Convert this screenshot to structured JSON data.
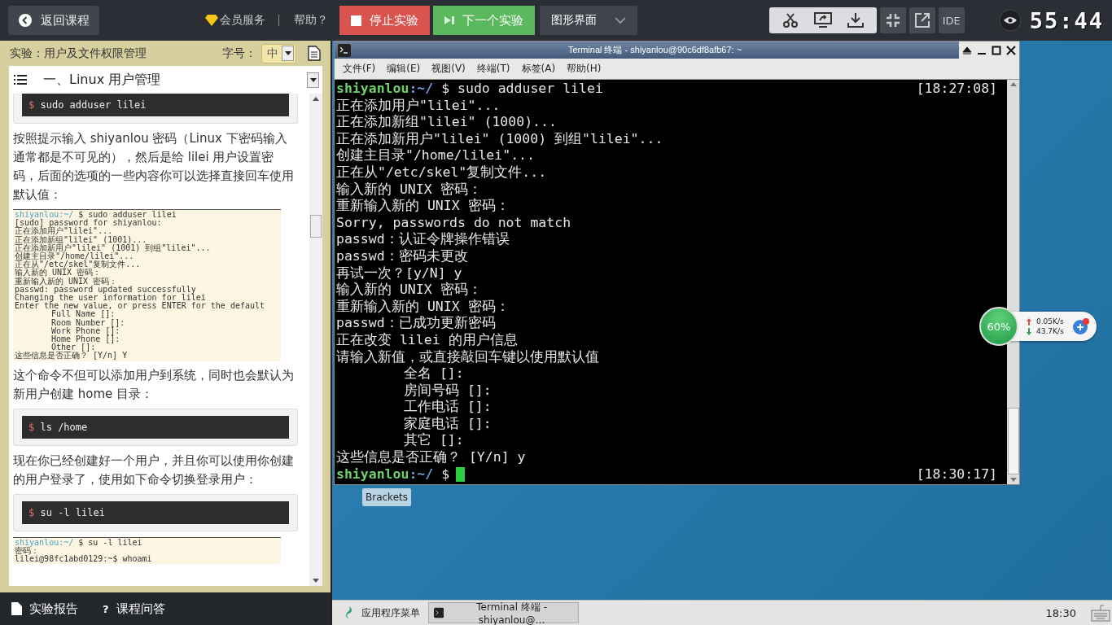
{
  "topbar": {
    "back_button": "返回课程",
    "vip_link": "会员服务",
    "help_link": "帮助？",
    "stop_button": "停止实验",
    "next_button": "下一个实验",
    "view_dropdown": "图形界面",
    "ide_button": "IDE",
    "timer": "55:44"
  },
  "lesson": {
    "title": "实验：用户及文件权限管理",
    "font_size_label": "字号：",
    "font_size_value": "中",
    "section": "一、Linux 用户管理",
    "blocks": [
      {
        "kind": "code",
        "prompt": "$",
        "text": "sudo adduser lilei"
      },
      {
        "kind": "paragraph",
        "text": "按照提示输入 shiyanlou 密码（Linux 下密码输入通常都是不可见的），然后是给 lilei 用户设置密码，后面的选项的一些内容你可以选择直接回车使用默认值："
      },
      {
        "kind": "screenshot",
        "user": "shiyanlou",
        "path": ":~/",
        "command": "$ sudo adduser lilei",
        "lines": [
          {
            "text": "[sudo] password for shiyanlou:",
            "indented": false
          },
          {
            "text": "正在添加用户\"lilei\"...",
            "indented": false
          },
          {
            "text": "正在添加新组\"lilei\" (1001)...",
            "indented": false
          },
          {
            "text": "正在添加新用户\"lilei\" (1001) 到组\"lilei\"...",
            "indented": false
          },
          {
            "text": "创建主目录\"/home/lilei\"...",
            "indented": false
          },
          {
            "text": "正在从\"/etc/skel\"复制文件...",
            "indented": false
          },
          {
            "text": "输入新的 UNIX 密码：",
            "indented": false
          },
          {
            "text": "重新输入新的 UNIX 密码：",
            "indented": false
          },
          {
            "text": "passwd: password updated successfully",
            "indented": false
          },
          {
            "text": "Changing the user information for lilei",
            "indented": false
          },
          {
            "text": "Enter the new value, or press ENTER for the default",
            "indented": false
          },
          {
            "text": "Full Name []:",
            "indented": true
          },
          {
            "text": "Room Number []:",
            "indented": true
          },
          {
            "text": "Work Phone []:",
            "indented": true
          },
          {
            "text": "Home Phone []:",
            "indented": true
          },
          {
            "text": "Other []:",
            "indented": true
          },
          {
            "text": "这些信息是否正确？ [Y/n] Y",
            "indented": false
          }
        ]
      },
      {
        "kind": "paragraph",
        "text": "这个命令不但可以添加用户到系统，同时也会默认为新用户创建 home 目录："
      },
      {
        "kind": "code",
        "prompt": "$",
        "text": "ls /home"
      },
      {
        "kind": "paragraph",
        "text": "现在你已经创建好一个用户，并且你可以使用你创建的用户登录了，使用如下命令切换登录用户："
      },
      {
        "kind": "code",
        "prompt": "$",
        "text": "su -l lilei"
      },
      {
        "kind": "screenshot",
        "user": "shiyanlou",
        "path": ":~/",
        "command": "$ su -l lilei",
        "lines": [
          {
            "text": "密码：",
            "indented": false
          },
          {
            "text": "lilei@98fc1abd0129:~$ whoami",
            "indented": false
          }
        ]
      }
    ],
    "bottom_tabs": [
      {
        "label": "实验报告"
      },
      {
        "label": "课程问答",
        "icon": "?"
      }
    ]
  },
  "terminal": {
    "title": "Terminal 终端 - shiyanlou@90c6df8afb67: ~",
    "menu": [
      "文件(F)",
      "编辑(E)",
      "视图(V)",
      "终端(T)",
      "标签(A)",
      "帮助(H)"
    ],
    "lines": [
      {
        "kind": "prompt",
        "user": "shiyanlou",
        "path": ":~/",
        "command": "$ sudo adduser lilei",
        "time": "[18:27:08]",
        "cursor": false
      },
      {
        "kind": "output",
        "text": "正在添加用户\"lilei\"..."
      },
      {
        "kind": "output",
        "text": "正在添加新组\"lilei\" (1000)..."
      },
      {
        "kind": "output",
        "text": "正在添加新用户\"lilei\" (1000) 到组\"lilei\"..."
      },
      {
        "kind": "output",
        "text": "创建主目录\"/home/lilei\"..."
      },
      {
        "kind": "output",
        "text": "正在从\"/etc/skel\"复制文件..."
      },
      {
        "kind": "output",
        "text": "输入新的 UNIX 密码："
      },
      {
        "kind": "output",
        "text": "重新输入新的 UNIX 密码："
      },
      {
        "kind": "output",
        "text": "Sorry, passwords do not match"
      },
      {
        "kind": "output",
        "text": "passwd：认证令牌操作错误"
      },
      {
        "kind": "output",
        "text": "passwd：密码未更改"
      },
      {
        "kind": "output",
        "text": "再试一次？[y/N] y"
      },
      {
        "kind": "output",
        "text": "输入新的 UNIX 密码："
      },
      {
        "kind": "output",
        "text": "重新输入新的 UNIX 密码："
      },
      {
        "kind": "output",
        "text": "passwd：已成功更新密码"
      },
      {
        "kind": "output",
        "text": "正在改变 lilei 的用户信息"
      },
      {
        "kind": "output",
        "text": "请输入新值，或直接敲回车键以使用默认值"
      },
      {
        "kind": "indented",
        "text": "全名 []:"
      },
      {
        "kind": "indented",
        "text": "房间号码 []:"
      },
      {
        "kind": "indented",
        "text": "工作电话 []:"
      },
      {
        "kind": "indented",
        "text": "家庭电话 []:"
      },
      {
        "kind": "indented",
        "text": "其它 []:"
      },
      {
        "kind": "output",
        "text": "这些信息是否正确？ [Y/n] y"
      },
      {
        "kind": "prompt",
        "user": "shiyanlou",
        "path": ":~/",
        "command": "$",
        "time": "[18:30:17]",
        "cursor": true
      }
    ]
  },
  "network_widget": {
    "percent": "60%",
    "upload": "0.05K/s",
    "download": "43.7K/s"
  },
  "desktop_icon": "Brackets",
  "taskbar": {
    "menu_button": "应用程序菜单",
    "task": "Terminal 终端 - shiyanlou@…",
    "clock": "18:30"
  }
}
